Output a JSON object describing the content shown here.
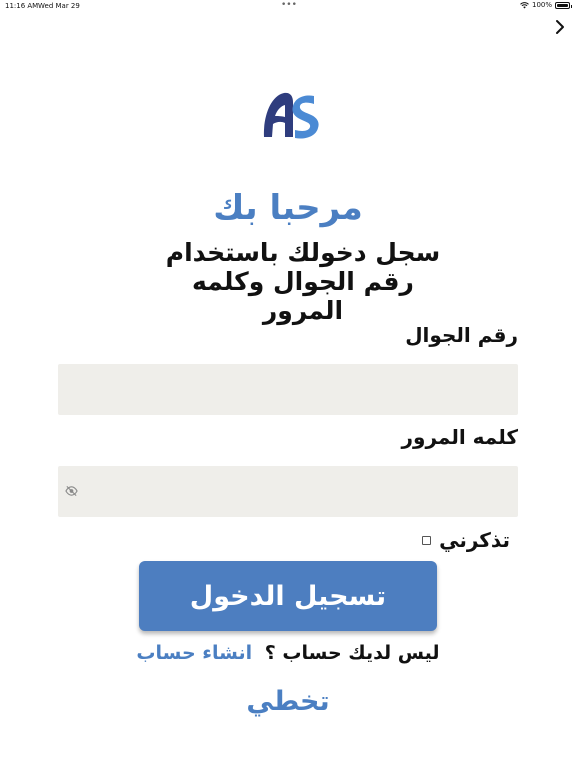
{
  "status_bar": {
    "time": "11:16 AM",
    "date": "Wed Mar 29",
    "multitask_dots": "•••",
    "battery_percent": "100%",
    "icons": [
      "wifi-icon",
      "battery-icon"
    ]
  },
  "nav": {
    "icon": "chevron-right-icon"
  },
  "logo": {
    "icon": "app-logo",
    "colors": {
      "primary": "#2f3d7e",
      "accent": "#4b8ad4"
    }
  },
  "header": {
    "welcome": "مرحبا بك",
    "subtitle": "سجل دخولك باستخدام رقم الجوال وكلمه المرور"
  },
  "form": {
    "phone_label": "رقم الجوال",
    "phone_value": "",
    "password_label": "كلمه المرور",
    "password_value": "",
    "password_toggle_icon": "eye-off-icon",
    "remember_label": "تذكرني",
    "remember_checked": false,
    "login_label": "تسجيل الدخول"
  },
  "footer": {
    "signup_question": "ليس لديك حساب ؟",
    "signup_link": "انشاء حساب",
    "skip_label": "تخطي"
  },
  "colors": {
    "accent": "#4b7fc2",
    "button": "#4d7ec0",
    "field_bg": "#efeeea"
  }
}
